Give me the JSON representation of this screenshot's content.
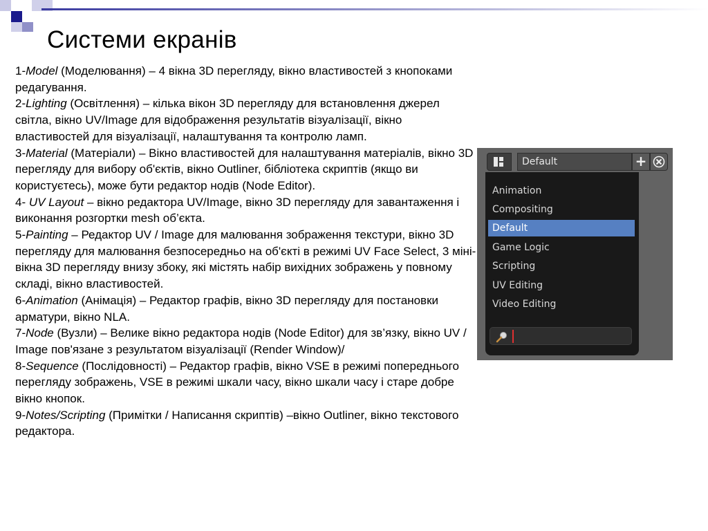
{
  "slide": {
    "title": "Системи екранів",
    "paragraphs": [
      {
        "num": "1-",
        "term": "Model",
        "rest": " (Моделювання) – 4 вікна 3D перегляду, вікно властивостей з кнопоками  редагування."
      },
      {
        "num": "2-",
        "term": "Lighting",
        "rest": " (Освітлення) – кілька вікон 3D перегляду для встановлення джерел світла, вікно UV/Image для відображення результатів візуалізації, вікно властивостей для візуалізації, налаштування  та контролю ламп."
      },
      {
        "num": "3-",
        "term": "Material",
        "rest": " (Матеріали) – Вікно властивостей для налаштування матеріалів, вікно 3D перегляду для вибору об'єктів, вікно Outliner, бібліотека скриптів (якщо ви користуєтесь), може бути редактор нодів (Node Editor)."
      },
      {
        "num": "4- ",
        "term": "UV Layout",
        "rest": " – вікно редактора UV/Image, вікно 3D перегляду для завантаження  і виконання  розгортки mesh об’єкта."
      },
      {
        "num": "5-",
        "term": "Painting",
        "rest": " – Редактор UV  /  Image для малювання  зображення текстури, вікно 3D перегляду для малювання безпосередньо на об'єкті в режимі  UV  Face Select, 3 міні-вікна  3D перегляду внизу збоку, які містять набір вихідних  зображень у повному складі, вікно властивостей."
      },
      {
        "num": "6-",
        "term": "Animation",
        "rest": " (Анімація) – Редактор графів, вікно 3D перегляду для постановки арматури, вікно NLA."
      },
      {
        "num": "7-",
        "term": "Node",
        "rest": " (Вузли) – Велике вікно редактора нодів (Node Editor) для зв’язку, вікно UV  /  Image пов'язане з результатом візуалізації  (Render Window)/"
      },
      {
        "num": "8-",
        "term": "Sequence",
        "rest": " (Послідовності) – Редактор графів, вікно VSE в режимі попереднього перегляду зображень, VSE в режимі  шкали часу, вікно шкали часу і старе добре вікно кнопок."
      },
      {
        "num": "9-",
        "term": "Notes/Scripting",
        "rest": " (Примітки  / Написання  скриптів) –вікно Outliner, вікно текстового редактора."
      }
    ]
  },
  "blender": {
    "current_layout": "Default",
    "add_symbol": "+",
    "remove_symbol": "⊗",
    "menu_items": [
      "Animation",
      "Compositing",
      "Default",
      "Game Logic",
      "Scripting",
      "UV Editing",
      "Video Editing"
    ],
    "active_item": "Default",
    "search_value": "",
    "colors": {
      "panel_bg": "#636363",
      "menu_bg": "#191919",
      "highlight": "#5680c2"
    }
  }
}
